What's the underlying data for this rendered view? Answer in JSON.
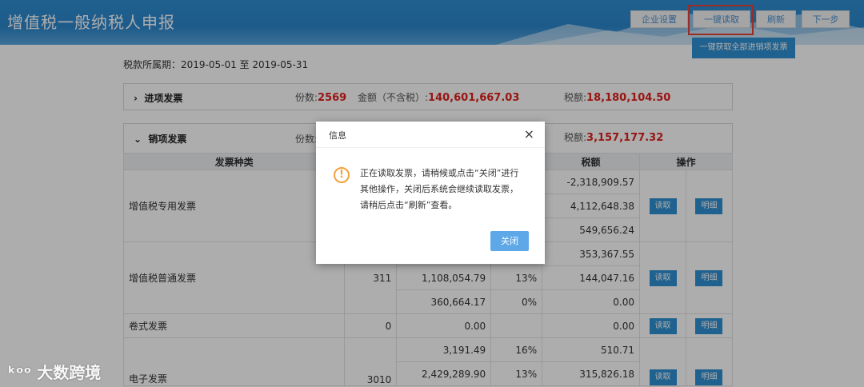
{
  "header": {
    "title": "增值税一般纳税人申报",
    "buttons": [
      "企业设置",
      "一键读取",
      "刷新",
      "下一步"
    ],
    "sub_button": "一键获取全部进销项发票",
    "highlight_color": "#e0433c",
    "accent_color": "#2f8fd3"
  },
  "period": "税款所属期：2019-05-01 至 2019-05-31",
  "input_invoices": {
    "title": "进项发票",
    "count_label": "份数:",
    "count": "2569",
    "amount_label": "金额（不含税）:",
    "amount": "140,601,667.03",
    "tax_label": "税额:",
    "tax": "18,180,104.50"
  },
  "output_invoices": {
    "title": "销项发票",
    "count_label": "份数:",
    "tax_label": "税额:",
    "tax": "3,157,177.32"
  },
  "table": {
    "headers": [
      "发票种类",
      "税额",
      "操作"
    ],
    "rows": [
      {
        "type": "增值税专用发票",
        "count": "",
        "amounts": [
          "",
          "",
          ""
        ],
        "rates": [
          "",
          "",
          ""
        ],
        "taxes": [
          "-2,318,909.57",
          "4,112,648.38",
          "549,656.24"
        ]
      },
      {
        "type": "增值税普通发票",
        "count": "311",
        "amounts": [
          "",
          "1,108,054.79",
          "360,664.17"
        ],
        "rates": [
          "",
          "13%",
          "0%"
        ],
        "taxes": [
          "353,367.55",
          "144,047.16",
          "0.00"
        ]
      },
      {
        "type": "卷式发票",
        "count": "0",
        "amounts": [
          "0.00"
        ],
        "rates": [
          ""
        ],
        "taxes": [
          "0.00"
        ]
      },
      {
        "type": "电子发票",
        "count": "3010",
        "amounts": [
          "3,191.49",
          "2,429,289.90"
        ],
        "rates": [
          "16%",
          "13%"
        ],
        "taxes": [
          "510.71",
          "315,826.18"
        ]
      }
    ],
    "read_label": "读取",
    "detail_label": "明细"
  },
  "dialog": {
    "title": "信息",
    "close_icon": "×",
    "message": "正在读取发票，请稍候或点击“关闭”进行其他操作，关闭后系统会继续读取发票，请稍后点击“刷新”查看。",
    "ok_label": "关闭"
  },
  "watermark": "大数跨境"
}
